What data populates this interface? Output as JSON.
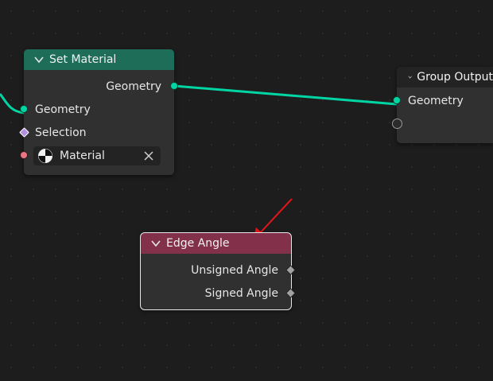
{
  "nodes": {
    "set_material": {
      "title": "Set Material",
      "output_geometry": "Geometry",
      "input_geometry": "Geometry",
      "input_selection": "Selection",
      "material_value": "Material"
    },
    "group_output": {
      "title": "Group Output",
      "input_geometry": "Geometry"
    },
    "edge_angle": {
      "title": "Edge Angle",
      "output_unsigned": "Unsigned Angle",
      "output_signed": "Signed Angle"
    }
  },
  "colors": {
    "canvas": "#1d1d1d",
    "node_body": "#303030",
    "set_material_header": "#1e6d58",
    "group_output_header": "#232323",
    "edge_angle_header": "#83314a",
    "geometry_socket": "#00d6a3",
    "material_socket": "#eb7582",
    "selection_socket": "#b48ee0",
    "float_socket": "#a1a1a1",
    "annotation_arrow": "#e8151b"
  },
  "icons": [
    "chevron-down-icon",
    "material-sphere-icon",
    "close-icon"
  ]
}
